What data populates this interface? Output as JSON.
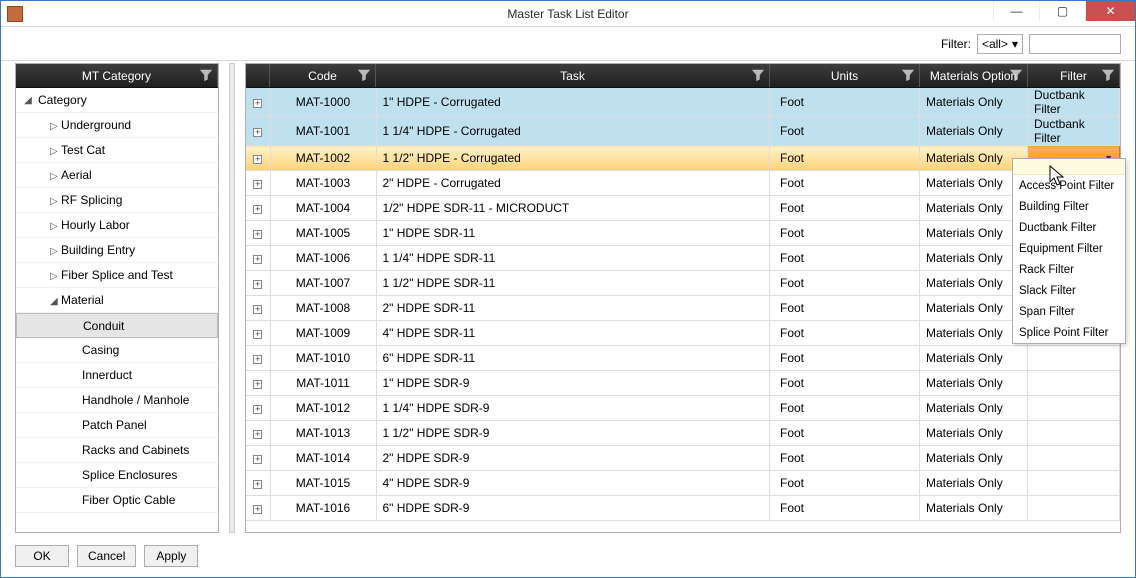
{
  "window": {
    "title": "Master Task List Editor"
  },
  "toolbar": {
    "filter_label": "Filter:",
    "filter_value": "<all>"
  },
  "leftHeader": "MT Category",
  "tree": {
    "root": "Category",
    "items": [
      "Underground",
      "Test Cat",
      "Aerial",
      "RF Splicing",
      "Hourly Labor",
      "Building Entry",
      "Fiber Splice and Test",
      "Material"
    ],
    "material_children": [
      "Conduit",
      "Casing",
      "Innerduct",
      "Handhole / Manhole",
      "Patch Panel",
      "Racks and Cabinets",
      "Splice Enclosures",
      "Fiber Optic Cable"
    ],
    "selected": "Conduit"
  },
  "gridHeaders": {
    "code": "Code",
    "task": "Task",
    "units": "Units",
    "materials": "Materials Option",
    "filter": "Filter"
  },
  "rows": [
    {
      "code": "MAT-1000",
      "task": "1\" HDPE - Corrugated",
      "units": "Foot",
      "mat": "Materials Only",
      "filter": "Ductbank Filter",
      "state": "blue"
    },
    {
      "code": "MAT-1001",
      "task": "1 1/4\" HDPE - Corrugated",
      "units": "Foot",
      "mat": "Materials Only",
      "filter": "Ductbank Filter",
      "state": "blue"
    },
    {
      "code": "MAT-1002",
      "task": "1 1/2\" HDPE - Corrugated",
      "units": "Foot",
      "mat": "Materials Only",
      "filter": "",
      "state": "orange"
    },
    {
      "code": "MAT-1003",
      "task": "2\" HDPE - Corrugated",
      "units": "Foot",
      "mat": "Materials Only",
      "filter": ""
    },
    {
      "code": "MAT-1004",
      "task": "1/2\" HDPE SDR-11 - MICRODUCT",
      "units": "Foot",
      "mat": "Materials Only",
      "filter": ""
    },
    {
      "code": "MAT-1005",
      "task": "1\" HDPE SDR-11",
      "units": "Foot",
      "mat": "Materials Only",
      "filter": ""
    },
    {
      "code": "MAT-1006",
      "task": "1 1/4\" HDPE SDR-11",
      "units": "Foot",
      "mat": "Materials Only",
      "filter": ""
    },
    {
      "code": "MAT-1007",
      "task": "1 1/2\" HDPE SDR-11",
      "units": "Foot",
      "mat": "Materials Only",
      "filter": ""
    },
    {
      "code": "MAT-1008",
      "task": "2\" HDPE SDR-11",
      "units": "Foot",
      "mat": "Materials Only",
      "filter": ""
    },
    {
      "code": "MAT-1009",
      "task": "4\" HDPE SDR-11",
      "units": "Foot",
      "mat": "Materials Only",
      "filter": ""
    },
    {
      "code": "MAT-1010",
      "task": "6\" HDPE SDR-11",
      "units": "Foot",
      "mat": "Materials Only",
      "filter": ""
    },
    {
      "code": "MAT-1011",
      "task": "1\" HDPE SDR-9",
      "units": "Foot",
      "mat": "Materials Only",
      "filter": ""
    },
    {
      "code": "MAT-1012",
      "task": "1 1/4\" HDPE SDR-9",
      "units": "Foot",
      "mat": "Materials Only",
      "filter": ""
    },
    {
      "code": "MAT-1013",
      "task": "1 1/2\" HDPE SDR-9",
      "units": "Foot",
      "mat": "Materials Only",
      "filter": ""
    },
    {
      "code": "MAT-1014",
      "task": "2\" HDPE SDR-9",
      "units": "Foot",
      "mat": "Materials Only",
      "filter": ""
    },
    {
      "code": "MAT-1015",
      "task": "4\" HDPE SDR-9",
      "units": "Foot",
      "mat": "Materials Only",
      "filter": ""
    },
    {
      "code": "MAT-1016",
      "task": "6\" HDPE SDR-9",
      "units": "Foot",
      "mat": "Materials Only",
      "filter": ""
    }
  ],
  "dropdown": [
    "Access Point Filter",
    "Building Filter",
    "Ductbank Filter",
    "Equipment Filter",
    "Rack Filter",
    "Slack Filter",
    "Span Filter",
    "Splice Point Filter"
  ],
  "buttons": {
    "ok": "OK",
    "cancel": "Cancel",
    "apply": "Apply"
  }
}
